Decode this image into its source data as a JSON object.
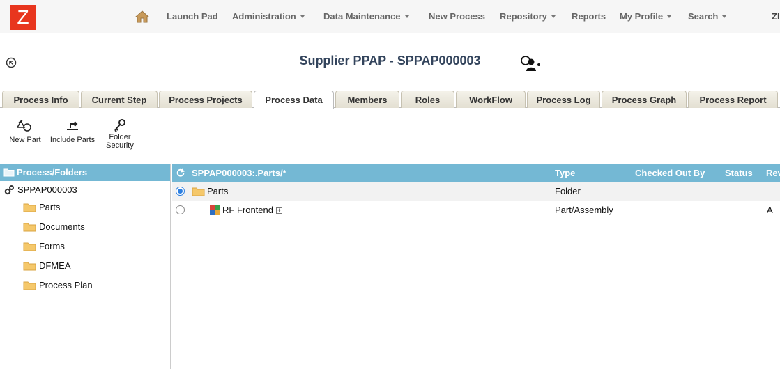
{
  "brand": {
    "logo_letter": "Z"
  },
  "nav": {
    "items": [
      {
        "label": "Launch Pad",
        "dropdown": false
      },
      {
        "label": "Administration",
        "dropdown": true
      },
      {
        "label": "Data Maintenance",
        "dropdown": true
      },
      {
        "label": "New Process",
        "dropdown": false
      },
      {
        "label": "Repository",
        "dropdown": true
      },
      {
        "label": "Reports",
        "dropdown": false
      },
      {
        "label": "My Profile",
        "dropdown": true
      },
      {
        "label": "Search",
        "dropdown": true
      }
    ],
    "user_initials": "ZI"
  },
  "page": {
    "title": "Supplier PPAP - SPPAP000003"
  },
  "tabs": [
    {
      "label": "Process Info"
    },
    {
      "label": "Current Step"
    },
    {
      "label": "Process Projects"
    },
    {
      "label": "Process Data",
      "active": true
    },
    {
      "label": "Members"
    },
    {
      "label": "Roles"
    },
    {
      "label": "WorkFlow"
    },
    {
      "label": "Process Log"
    },
    {
      "label": "Process Graph"
    },
    {
      "label": "Process Report"
    }
  ],
  "toolbar": {
    "new_part": "New Part",
    "include_parts": "Include Parts",
    "folder_security_line1": "Folder",
    "folder_security_line2": "Security"
  },
  "left_pane": {
    "header": "Process/Folders",
    "root": "SPPAP000003",
    "folders": [
      "Parts",
      "Documents",
      "Forms",
      "DFMEA",
      "Process Plan"
    ]
  },
  "grid": {
    "path": "SPPAP000003:.Parts/*",
    "columns": {
      "type": "Type",
      "checked_out_by": "Checked Out By",
      "status": "Status",
      "rev": "Rev"
    },
    "rows": [
      {
        "name": "Parts",
        "type": "Folder",
        "checked_out_by": "",
        "status": "",
        "rev": "",
        "selected": true
      },
      {
        "name": "RF Frontend",
        "type": "Part/Assembly",
        "checked_out_by": "",
        "status": "",
        "rev": "A",
        "selected": false
      }
    ]
  },
  "colors": {
    "accent_header": "#74b8d4",
    "logo_red": "#e8361e",
    "title": "#33445c",
    "folder": "#f5c86b"
  }
}
